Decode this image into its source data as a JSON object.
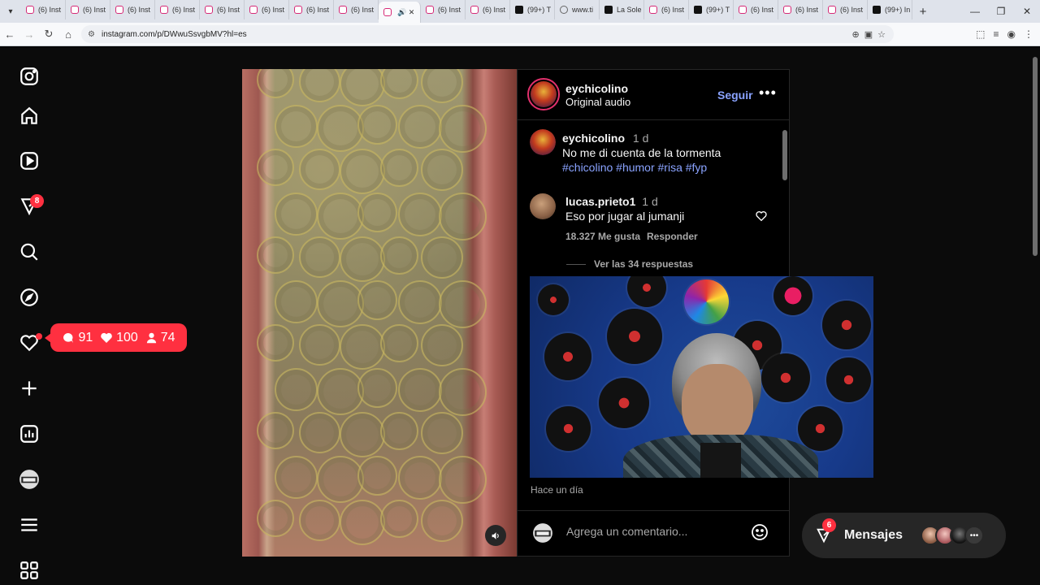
{
  "browser": {
    "tabs": [
      {
        "label": "(6) Inst",
        "icon": "instagram-icon"
      },
      {
        "label": "(6) Inst",
        "icon": "instagram-icon"
      },
      {
        "label": "(6) Inst",
        "icon": "instagram-icon"
      },
      {
        "label": "(6) Inst",
        "icon": "instagram-icon"
      },
      {
        "label": "(6) Inst",
        "icon": "instagram-icon"
      },
      {
        "label": "(6) Inst",
        "icon": "instagram-icon"
      },
      {
        "label": "(6) Inst",
        "icon": "instagram-icon"
      },
      {
        "label": "(6) Inst",
        "icon": "instagram-icon"
      },
      {
        "label": "",
        "icon": "instagram-icon",
        "active": true
      },
      {
        "label": "(6) Inst",
        "icon": "instagram-icon"
      },
      {
        "label": "(6) Inst",
        "icon": "instagram-icon"
      },
      {
        "label": "(99+) T",
        "icon": "tiktok-icon"
      },
      {
        "label": "www.ti",
        "icon": "globe-icon"
      },
      {
        "label": "La Sole",
        "icon": "x-icon"
      },
      {
        "label": "(6) Inst",
        "icon": "instagram-icon"
      },
      {
        "label": "(99+) T",
        "icon": "tiktok-icon"
      },
      {
        "label": "(6) Inst",
        "icon": "instagram-icon"
      },
      {
        "label": "(6) Inst",
        "icon": "instagram-icon"
      },
      {
        "label": "(6) Inst",
        "icon": "instagram-icon"
      },
      {
        "label": "(99+) In",
        "icon": "tiktok-icon"
      }
    ],
    "url": "instagram.com/p/DWwuSsvgbMV?hl=es"
  },
  "sidebar": {
    "notifications_badge": "8"
  },
  "notification_pill": {
    "comments": "91",
    "likes": "100",
    "followers": "74"
  },
  "post": {
    "author": "eychicolino",
    "audio": "Original audio",
    "follow_label": "Seguir",
    "caption": {
      "author": "eychicolino",
      "time": "1 d",
      "text": "No me di cuenta de la tormenta",
      "tags": "#chicolino #humor #risa #fyp"
    },
    "comment": {
      "author": "lucas.prieto1",
      "time": "1 d",
      "text": "Eso por jugar al jumanji",
      "likes": "18.327 Me gusta",
      "reply_label": "Responder",
      "view_replies": "Ver las 34 respuestas"
    },
    "time_ago": "Hace un día",
    "comment_placeholder": "Agrega un comentario..."
  },
  "messages": {
    "label": "Mensajes",
    "badge": "6"
  }
}
